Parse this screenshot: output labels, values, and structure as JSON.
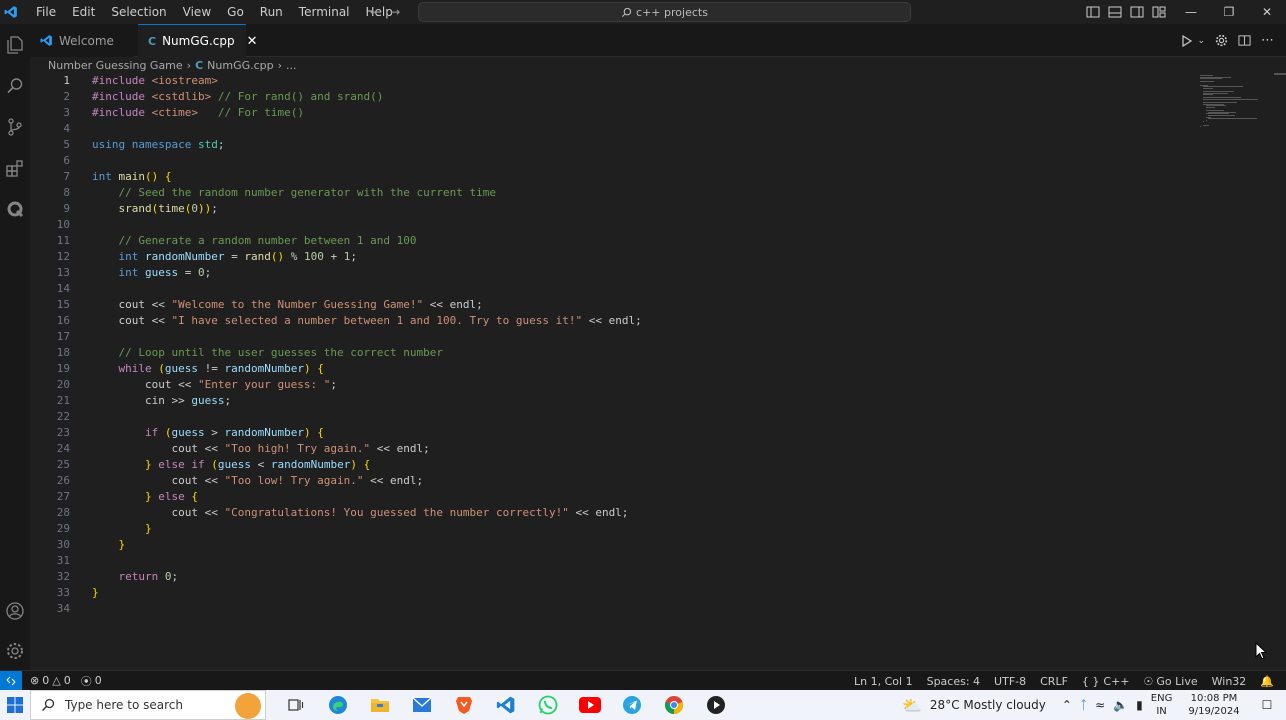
{
  "titlebar": {
    "menu": [
      "File",
      "Edit",
      "Selection",
      "View",
      "Go",
      "Run",
      "Terminal",
      "Help"
    ],
    "command_center": "c++ projects"
  },
  "tabs": [
    {
      "label": "Welcome",
      "active": false
    },
    {
      "label": "NumGG.cpp",
      "active": true
    }
  ],
  "breadcrumb": {
    "folder": "Number Guessing Game",
    "file": "NumGG.cpp",
    "more": "..."
  },
  "editor": {
    "current_line": 1,
    "lines": [
      {
        "n": "1",
        "text": "#include <iostream>"
      },
      {
        "n": "2",
        "text": "#include <cstdlib> // For rand() and srand()"
      },
      {
        "n": "3",
        "text": "#include <ctime>   // For time()"
      },
      {
        "n": "4",
        "text": ""
      },
      {
        "n": "5",
        "text": "using namespace std;"
      },
      {
        "n": "6",
        "text": ""
      },
      {
        "n": "7",
        "text": "int main() {"
      },
      {
        "n": "8",
        "text": "    // Seed the random number generator with the current time"
      },
      {
        "n": "9",
        "text": "    srand(time(0));"
      },
      {
        "n": "10",
        "text": ""
      },
      {
        "n": "11",
        "text": "    // Generate a random number between 1 and 100"
      },
      {
        "n": "12",
        "text": "    int randomNumber = rand() % 100 + 1;"
      },
      {
        "n": "13",
        "text": "    int guess = 0;"
      },
      {
        "n": "14",
        "text": ""
      },
      {
        "n": "15",
        "text": "    cout << \"Welcome to the Number Guessing Game!\" << endl;"
      },
      {
        "n": "16",
        "text": "    cout << \"I have selected a number between 1 and 100. Try to guess it!\" << endl;"
      },
      {
        "n": "17",
        "text": ""
      },
      {
        "n": "18",
        "text": "    // Loop until the user guesses the correct number"
      },
      {
        "n": "19",
        "text": "    while (guess != randomNumber) {"
      },
      {
        "n": "20",
        "text": "        cout << \"Enter your guess: \";"
      },
      {
        "n": "21",
        "text": "        cin >> guess;"
      },
      {
        "n": "22",
        "text": ""
      },
      {
        "n": "23",
        "text": "        if (guess > randomNumber) {"
      },
      {
        "n": "24",
        "text": "            cout << \"Too high! Try again.\" << endl;"
      },
      {
        "n": "25",
        "text": "        } else if (guess < randomNumber) {"
      },
      {
        "n": "26",
        "text": "            cout << \"Too low! Try again.\" << endl;"
      },
      {
        "n": "27",
        "text": "        } else {"
      },
      {
        "n": "28",
        "text": "            cout << \"Congratulations! You guessed the number correctly!\" << endl;"
      },
      {
        "n": "29",
        "text": "        }"
      },
      {
        "n": "30",
        "text": "    }"
      },
      {
        "n": "31",
        "text": ""
      },
      {
        "n": "32",
        "text": "    return 0;"
      },
      {
        "n": "33",
        "text": "}"
      },
      {
        "n": "34",
        "text": ""
      }
    ]
  },
  "statusbar": {
    "errors": "0",
    "warnings": "0",
    "ports": "0",
    "position": "Ln 1, Col 1",
    "spaces": "Spaces: 4",
    "encoding": "UTF-8",
    "eol": "CRLF",
    "language": "C++",
    "golive": "Go Live",
    "platform": "Win32"
  },
  "taskbar": {
    "search_placeholder": "Type here to search",
    "weather": "28°C  Mostly cloudy",
    "lang_top": "ENG",
    "lang_bottom": "IN",
    "time": "10:08 PM",
    "date": "9/19/2024"
  },
  "colors": {
    "accent": "#0078d4",
    "editor_bg": "#1f1f1f",
    "keyword": "#569cd6",
    "string": "#ce9178",
    "comment": "#6a9955"
  }
}
